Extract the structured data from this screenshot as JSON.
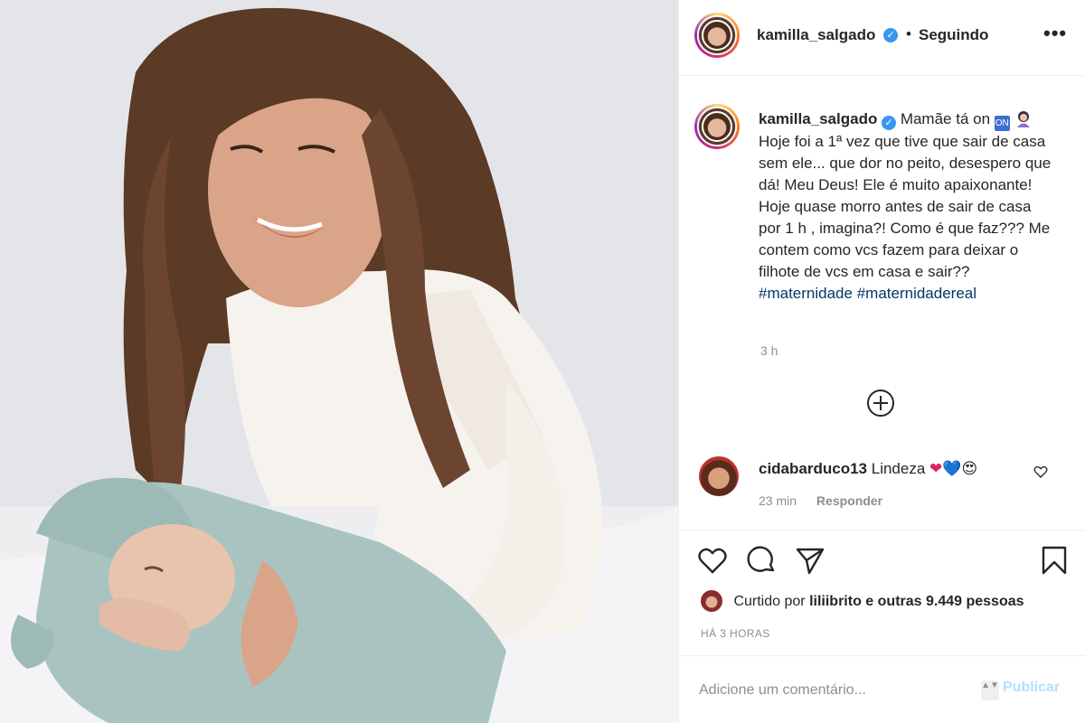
{
  "post": {
    "username": "kamilla_salgado",
    "verified_glyph": "✓",
    "follow_status": "Seguindo",
    "more_glyph": "•••",
    "caption_intro": "Mamãe tá on",
    "caption_body": "Hoje foi a 1ª vez que tive que sair de casa sem ele... que dor no peito, desespero que dá! Meu Deus! Ele é muito apaixonante! Hoje quase morro antes de sair de casa por 1 h , imagina?! Como é que faz??? Me contem como vcs fazem para deixar o filhote de vcs em casa e sair??",
    "hashtags": [
      "#maternidade",
      "#maternidadereal"
    ],
    "time_ago": "3 h",
    "on_emoji": "ON"
  },
  "comment": {
    "username": "cidabarduco13",
    "text": "Lindeza",
    "hearts": [
      "❤",
      "💙",
      "😍"
    ],
    "age": "23 min",
    "reply_label": "Responder"
  },
  "likes": {
    "prefix": "Curtido por",
    "liker": "liliibrito",
    "suffix": "e outras 9.449 pessoas"
  },
  "posted_label": "HÁ 3 HORAS",
  "comment_box": {
    "placeholder": "Adicione um comentário...",
    "publish_label": "Publicar",
    "spinner_glyph": "▲▼"
  },
  "colors": {
    "verified": "#3897f0",
    "hashtag": "#00376b",
    "publish_disabled": "#b2dffc",
    "muted": "#8e8e8e"
  },
  "icons": [
    "more-options-icon",
    "load-more-comments-icon",
    "like-icon",
    "comment-icon",
    "share-icon",
    "save-icon",
    "comment-like-icon"
  ]
}
